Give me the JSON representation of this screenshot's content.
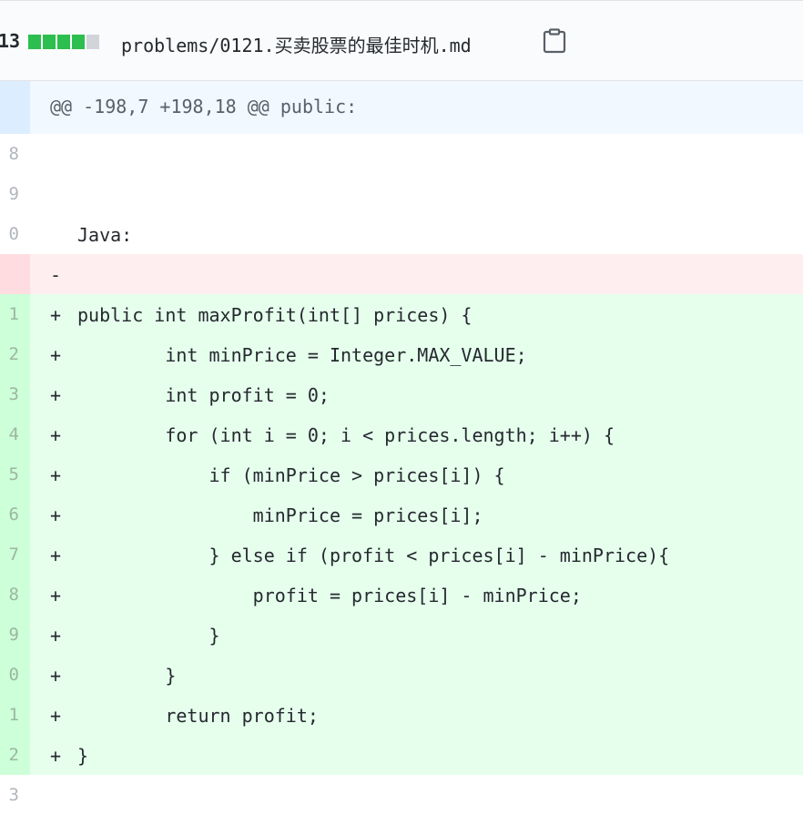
{
  "file_header": {
    "change_count": "13",
    "diffstat": [
      "add",
      "add",
      "add",
      "add",
      "neutral"
    ],
    "path": "problems/0121.买卖股票的最佳时机.md",
    "copy_icon": "clipboard-icon"
  },
  "diff": {
    "hunk_header": "@@ -198,7 +198,18 @@ public:",
    "rows": [
      {
        "type": "ctx",
        "num": "8",
        "sign": "",
        "text": ""
      },
      {
        "type": "ctx",
        "num": "9",
        "sign": "",
        "text": ""
      },
      {
        "type": "ctx",
        "num": "0",
        "sign": "",
        "text": "Java:"
      },
      {
        "type": "del",
        "num": "",
        "sign": "-",
        "text": ""
      },
      {
        "type": "add",
        "num": "1",
        "sign": "+",
        "text": "public int maxProfit(int[] prices) {"
      },
      {
        "type": "add",
        "num": "2",
        "sign": "+",
        "text": "        int minPrice = Integer.MAX_VALUE;"
      },
      {
        "type": "add",
        "num": "3",
        "sign": "+",
        "text": "        int profit = 0;"
      },
      {
        "type": "add",
        "num": "4",
        "sign": "+",
        "text": "        for (int i = 0; i < prices.length; i++) {"
      },
      {
        "type": "add",
        "num": "5",
        "sign": "+",
        "text": "            if (minPrice > prices[i]) {"
      },
      {
        "type": "add",
        "num": "6",
        "sign": "+",
        "text": "                minPrice = prices[i];"
      },
      {
        "type": "add",
        "num": "7",
        "sign": "+",
        "text": "            } else if (profit < prices[i] - minPrice){"
      },
      {
        "type": "add",
        "num": "8",
        "sign": "+",
        "text": "                profit = prices[i] - minPrice;"
      },
      {
        "type": "add",
        "num": "9",
        "sign": "+",
        "text": "            }"
      },
      {
        "type": "add",
        "num": "0",
        "sign": "+",
        "text": "        }"
      },
      {
        "type": "add",
        "num": "1",
        "sign": "+",
        "text": "        return profit;"
      },
      {
        "type": "add",
        "num": "2",
        "sign": "+",
        "text": "}"
      },
      {
        "type": "ctx",
        "num": "3",
        "sign": "",
        "text": ""
      }
    ]
  },
  "colors": {
    "add_bg": "#e6ffed",
    "add_num_bg": "#cdffd8",
    "del_bg": "#ffeef0",
    "del_num_bg": "#ffdce0",
    "hunk_bg": "#f1f8ff",
    "hunk_num_bg": "#dbedff",
    "diffstat_add": "#2cbe4e",
    "diffstat_neutral": "#d1d5da"
  }
}
